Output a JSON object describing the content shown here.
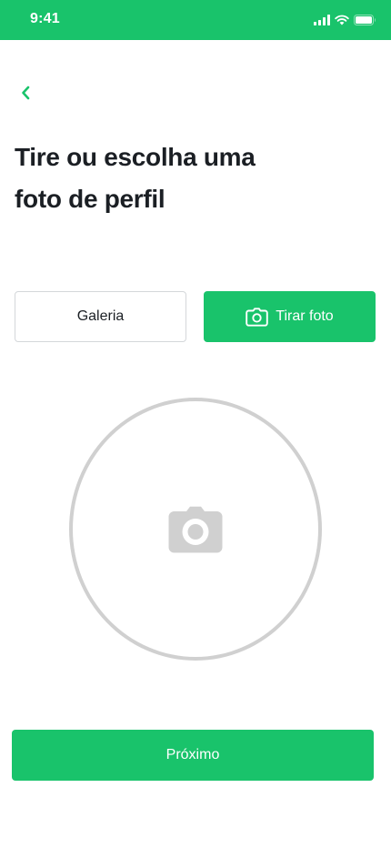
{
  "status_bar": {
    "time": "9:41",
    "icons": [
      "signal-icon",
      "wifi-icon",
      "battery-icon"
    ],
    "background_color": "#19c36b"
  },
  "navigation": {
    "back_icon": "chevron-left-icon"
  },
  "title_lines": [
    "Tire ou escolha uma",
    "foto de perfil"
  ],
  "actions": {
    "gallery_label": "Galeria",
    "camera_label": "Tirar foto",
    "camera_icon": "camera-icon"
  },
  "photo_placeholder": {
    "icon": "camera-icon"
  },
  "footer": {
    "next_label": "Próximo"
  },
  "colors": {
    "accent": "#19c36b",
    "text": "#1b1f24",
    "placeholder": "#d0d0d0",
    "border": "#d4d7da"
  }
}
